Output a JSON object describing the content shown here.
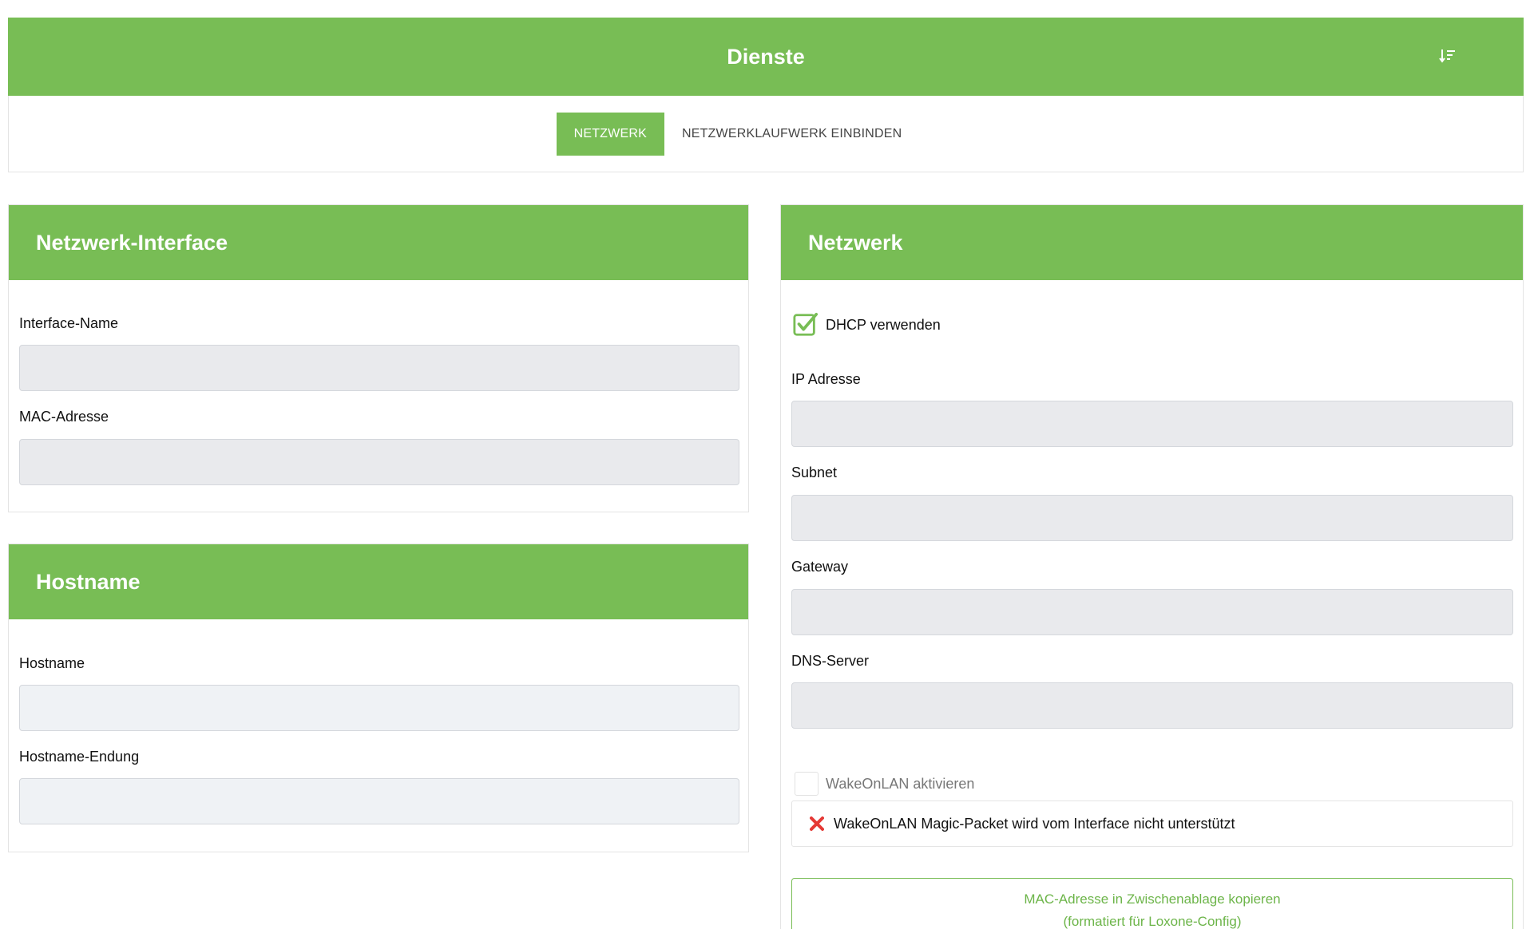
{
  "header": {
    "title": "Dienste",
    "sort_icon": "sort-descending-icon"
  },
  "tabs": [
    {
      "label": "NETZWERK",
      "active": true
    },
    {
      "label": "NETZWERKLAUFWERK EINBINDEN",
      "active": false
    }
  ],
  "interface_card": {
    "title": "Netzwerk-Interface",
    "interface_name": {
      "label": "Interface-Name",
      "value": ""
    },
    "mac_address": {
      "label": "MAC-Adresse",
      "value": ""
    }
  },
  "hostname_card": {
    "title": "Hostname",
    "hostname": {
      "label": "Hostname",
      "value": ""
    },
    "hostname_suffix": {
      "label": "Hostname-Endung",
      "value": ""
    }
  },
  "network_card": {
    "title": "Netzwerk",
    "dhcp": {
      "label": "DHCP verwenden",
      "checked": true
    },
    "ip_address": {
      "label": "IP Adresse",
      "value": ""
    },
    "subnet": {
      "label": "Subnet",
      "value": ""
    },
    "gateway": {
      "label": "Gateway",
      "value": ""
    },
    "dns_server": {
      "label": "DNS-Server",
      "value": ""
    },
    "wol": {
      "label": "WakeOnLAN aktivieren",
      "checked": false
    },
    "wol_notice": "WakeOnLAN Magic-Packet wird vom Interface nicht unterstützt",
    "copy_button": {
      "line1": "MAC-Adresse in Zwischenablage kopieren",
      "line2": "(formatiert für Loxone-Config)"
    }
  },
  "colors": {
    "accent": "#78bd55",
    "input_bg": "#e9eaed",
    "error": "#e53935"
  }
}
